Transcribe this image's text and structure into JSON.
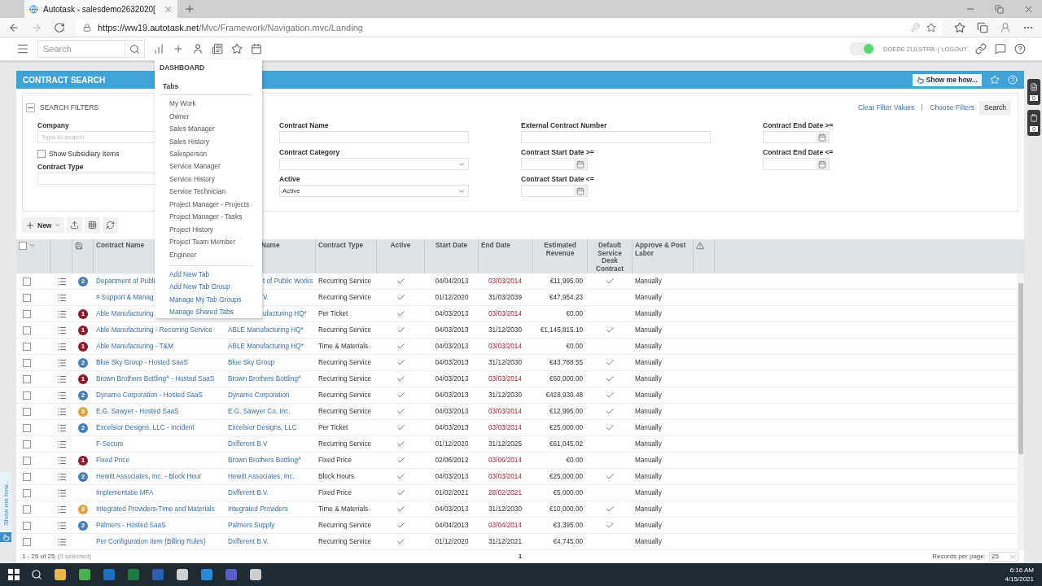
{
  "browser": {
    "tab_title": "Autotask - salesdemo2632020[",
    "url_host": "https://ww19.autotask.net",
    "url_path": "/Mvc/Framework/Navigation.mvc/Landing"
  },
  "app_header": {
    "search_placeholder": "Search",
    "status_on": true,
    "user": "DOEDE ZIJLSTRA",
    "separator": "|",
    "logout": "LOGOUT"
  },
  "dashboard_menu": {
    "title": "DASHBOARD",
    "section": "Tabs",
    "items": [
      "My Work",
      "Owner",
      "Sales Manager",
      "Sales History",
      "Salesperson",
      "Service Manager",
      "Service History",
      "Service Technician",
      "Project Manager - Projects",
      "Project Manager - Tasks",
      "Project History",
      "Project Team Member",
      "Engineer"
    ],
    "actions": [
      "Add New Tab",
      "Add New Tab Group",
      "Manage My Tab Groups",
      "Manage Shared Tabs"
    ]
  },
  "page": {
    "title": "CONTRACT SEARCH",
    "help_button": "Show me how..."
  },
  "filters": {
    "title": "SEARCH FILTERS",
    "expanded": true,
    "links": [
      "Clear Filter Values",
      "Choose Filters"
    ],
    "search_button": "Search",
    "columns": [
      [
        {
          "kind": "text",
          "label": "Company",
          "placeholder": "Type to search"
        },
        {
          "kind": "checkbox",
          "label": "Show Subsidiary Items",
          "checked": false
        },
        {
          "kind": "text",
          "label": "Contract Type"
        }
      ],
      [
        {
          "kind": "text",
          "label": "Contract Name"
        },
        {
          "kind": "select",
          "label": "Contract Category"
        },
        {
          "kind": "select",
          "label": "Active",
          "value": "Active"
        }
      ],
      [
        {
          "kind": "text",
          "label": "External Contract Number"
        },
        {
          "kind": "date",
          "label": "Contract Start Date >="
        },
        {
          "kind": "date",
          "label": "Contract Start Date <="
        }
      ],
      [
        {
          "kind": "date",
          "label": "Contract End Date >="
        },
        {
          "kind": "date",
          "label": "Contract End Date <="
        }
      ]
    ]
  },
  "toolbar": {
    "new_button": "New"
  },
  "table": {
    "all_checked": false,
    "columns": [
      {
        "label": "Contract Name"
      },
      {
        "label": "Name",
        "cut": true
      },
      {
        "label": "Contract Type"
      },
      {
        "label": "Active"
      },
      {
        "label": "Start Date"
      },
      {
        "label": "End Date"
      },
      {
        "label": "Estimated Revenue"
      },
      {
        "label": "Default Service Desk Contract"
      },
      {
        "label": "Approve & Post Labor"
      }
    ],
    "rows": [
      {
        "checked": false,
        "priority": "2",
        "color": "#4a7db5",
        "name": "Department of Publi",
        "company": "t of Public Works",
        "company_cut": true,
        "type": "Recurring Service",
        "active": true,
        "start": "04/04/2013",
        "end": "03/03/2014",
        "expired": true,
        "revenue": "€11,995.00",
        "service_desk": true,
        "approve": "Manually"
      },
      {
        "checked": false,
        "name": "# Support & Manag",
        "company": "V.",
        "company_cut": true,
        "type": "Recurring Service",
        "active": true,
        "start": "01/12/2020",
        "end": "31/03/2039",
        "expired": false,
        "revenue": "€47,954.23",
        "service_desk": false,
        "approve": "Manually"
      },
      {
        "checked": false,
        "priority": "1",
        "color": "#8a1c2e",
        "name": "Able Manufacturing",
        "company": "ufacturing HQ*",
        "company_cut": true,
        "type": "Per Ticket",
        "active": true,
        "start": "04/03/2013",
        "end": "03/03/2014",
        "expired": true,
        "revenue": "€0.00",
        "service_desk": false,
        "approve": "Manually"
      },
      {
        "checked": false,
        "priority": "1",
        "color": "#8a1c2e",
        "name": "Able Manufacturing - Recurring Service",
        "company": "ABLE Manufacturing HQ*",
        "type": "Recurring Service",
        "active": true,
        "start": "04/03/2013",
        "end": "31/12/2030",
        "expired": false,
        "revenue": "€1,145,815.10",
        "service_desk": true,
        "approve": "Manually"
      },
      {
        "checked": false,
        "priority": "1",
        "color": "#8a1c2e",
        "name": "Able Manufacturing - T&M",
        "company": "ABLE Manufacturing HQ*",
        "type": "Time & Materials",
        "active": true,
        "start": "04/03/2013",
        "end": "03/03/2014",
        "expired": true,
        "revenue": "€0.00",
        "service_desk": false,
        "approve": "Manually"
      },
      {
        "checked": false,
        "priority": "2",
        "color": "#4a7db5",
        "name": "Blue Sky Group - Hosted SaaS",
        "company": "Blue Sky Group",
        "type": "Recurring Service",
        "active": true,
        "start": "04/03/2013",
        "end": "31/12/2030",
        "expired": false,
        "revenue": "€43,788.55",
        "service_desk": true,
        "approve": "Manually"
      },
      {
        "checked": false,
        "priority": "1",
        "color": "#8a1c2e",
        "name": "Brown Brothers Bottling^ - Hosted SaaS",
        "company": "Brown Brothers Bottling^",
        "type": "Recurring Service",
        "active": true,
        "start": "04/03/2013",
        "end": "03/03/2014",
        "expired": true,
        "revenue": "€60,000.00",
        "service_desk": true,
        "approve": "Manually"
      },
      {
        "checked": false,
        "priority": "2",
        "color": "#4a7db5",
        "name": "Dynamo Corporation - Hosted SaaS",
        "company": "Dynamo Corporation",
        "type": "Recurring Service",
        "active": true,
        "start": "04/03/2013",
        "end": "31/12/2030",
        "expired": false,
        "revenue": "€428,930.48",
        "service_desk": true,
        "approve": "Manually"
      },
      {
        "checked": false,
        "priority": "3",
        "color": "#d9a441",
        "name": "E.G. Sawyer - Hosted SaaS",
        "company": "E.G. Sawyer Co. Inc.",
        "type": "Recurring Service",
        "active": true,
        "start": "04/03/2013",
        "end": "03/03/2014",
        "expired": true,
        "revenue": "€12,995.00",
        "service_desk": true,
        "approve": "Manually"
      },
      {
        "checked": false,
        "priority": "2",
        "color": "#4a7db5",
        "name": "Excelsior Designs, LLC - Incident",
        "company": "Excelsior Designs, LLC",
        "type": "Per Ticket",
        "active": true,
        "start": "04/03/2013",
        "end": "03/03/2014",
        "expired": true,
        "revenue": "€25,000.00",
        "service_desk": true,
        "approve": "Manually"
      },
      {
        "checked": false,
        "name": "F-Secure",
        "company": "Dxfferent B.V",
        "type": "Recurring Service",
        "active": true,
        "start": "01/12/2020",
        "end": "31/12/2025",
        "expired": false,
        "revenue": "€61,045.02",
        "service_desk": false,
        "approve": "Manually"
      },
      {
        "checked": false,
        "priority": "1",
        "color": "#8a1c2e",
        "name": "Fixed Price",
        "company": "Brown Brothers Bottling^",
        "type": "Fixed Price",
        "active": true,
        "start": "02/06/2012",
        "end": "03/06/2014",
        "expired": true,
        "revenue": "€0.00",
        "service_desk": false,
        "approve": "Manually"
      },
      {
        "checked": false,
        "priority": "2",
        "color": "#4a7db5",
        "name": "Hewitt Associates, Inc. - Block Hour",
        "company": "Hewitt Associates, Inc.",
        "type": "Block Hours",
        "active": true,
        "start": "04/03/2013",
        "end": "03/03/2014",
        "expired": true,
        "revenue": "€25,000.00",
        "service_desk": true,
        "approve": "Manually"
      },
      {
        "checked": false,
        "name": "Implementatie MFA",
        "company": "Dxfferent B.V.",
        "type": "Fixed Price",
        "active": true,
        "start": "01/02/2021",
        "end": "28/02/2021",
        "expired": true,
        "revenue": "€5,000.00",
        "service_desk": false,
        "approve": "Manually"
      },
      {
        "checked": false,
        "priority": "3",
        "color": "#d9a441",
        "name": "Integrated Providers-Time and Materials",
        "company": "Integrated Providers",
        "type": "Time & Materials",
        "active": true,
        "start": "04/03/2013",
        "end": "31/12/2030",
        "expired": false,
        "revenue": "€10,000.00",
        "service_desk": true,
        "approve": "Manually"
      },
      {
        "checked": false,
        "priority": "2",
        "color": "#4a7db5",
        "name": "Palmers - Hosted SaaS",
        "company": "Palmers Supply",
        "type": "Recurring Service",
        "active": true,
        "start": "04/04/2013",
        "end": "03/04/2014",
        "expired": true,
        "revenue": "€3,395.00",
        "service_desk": true,
        "approve": "Manually"
      },
      {
        "checked": false,
        "name": "Per Configuration Item (Billing Rules)",
        "company": "Dxfferent B.V.",
        "type": "Recurring Service",
        "active": true,
        "start": "01/12/2020",
        "end": "31/12/2021",
        "expired": false,
        "revenue": "€4,745.00",
        "service_desk": false,
        "approve": "Manually"
      }
    ]
  },
  "footer": {
    "range": "1 - 25 of 25",
    "selected": "(0 selected)",
    "page": "1",
    "per_page_label": "Records per page:",
    "per_page": "25"
  },
  "side_counters": [
    "0",
    "0"
  ],
  "side_tab": "Show me how...",
  "taskbar": {
    "time": "6:16 AM",
    "date": "4/15/2021"
  }
}
